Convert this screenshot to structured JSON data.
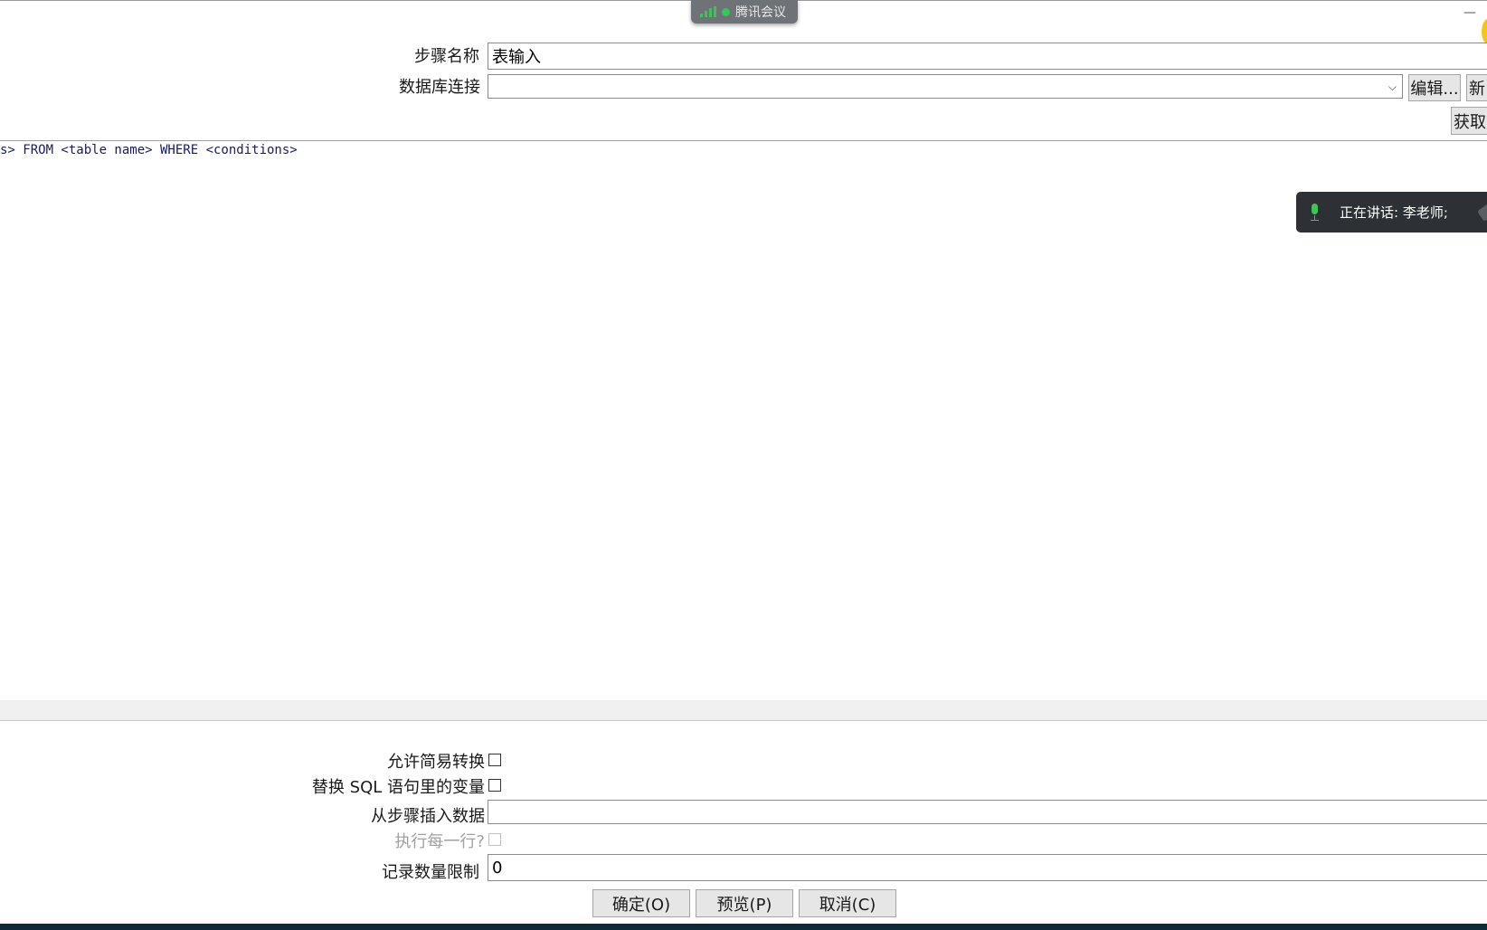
{
  "meeting_bar": {
    "title": "腾讯会议"
  },
  "window_controls": {
    "minimize": "—"
  },
  "form": {
    "step_name_label": "步骤名称",
    "step_name_value": "表输入",
    "db_connection_label": "数据库连接",
    "db_connection_value": "",
    "edit_button": "编辑...",
    "new_button": "新",
    "get_sql_button": "获取"
  },
  "sql": {
    "text": "s> FROM <table name> WHERE <conditions>"
  },
  "speaking_toast": {
    "text": "正在讲话: 李老师;",
    "icon": "mic-icon"
  },
  "options": {
    "lazy_conversion_label": "允许简易转换",
    "lazy_conversion_checked": false,
    "replace_variables_label": "替换 SQL 语句里的变量",
    "replace_variables_checked": false,
    "insert_from_step_label": "从步骤插入数据",
    "insert_from_step_value": "",
    "execute_each_row_label": "执行每一行?",
    "execute_each_row_checked": false,
    "limit_label": "记录数量限制",
    "limit_value": "0"
  },
  "buttons": {
    "ok": "确定(O)",
    "preview": "预览(P)",
    "cancel": "取消(C)"
  }
}
